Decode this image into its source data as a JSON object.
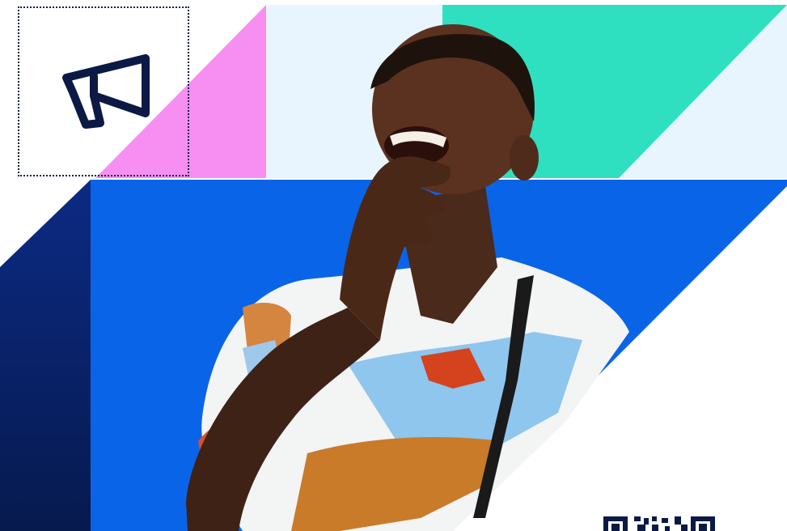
{
  "poster": {
    "icon": "megaphone-icon",
    "photo_subject": "person-photo",
    "qr_code": "qr-code-icon"
  },
  "colors": {
    "navy": "#0b1a45",
    "royal_blue": "#0a64e8",
    "pink": "#f78ef2",
    "light_blue": "#e8f5ff",
    "teal": "#2fe0c0",
    "white": "#ffffff",
    "dark_navy": "#061a4e"
  }
}
